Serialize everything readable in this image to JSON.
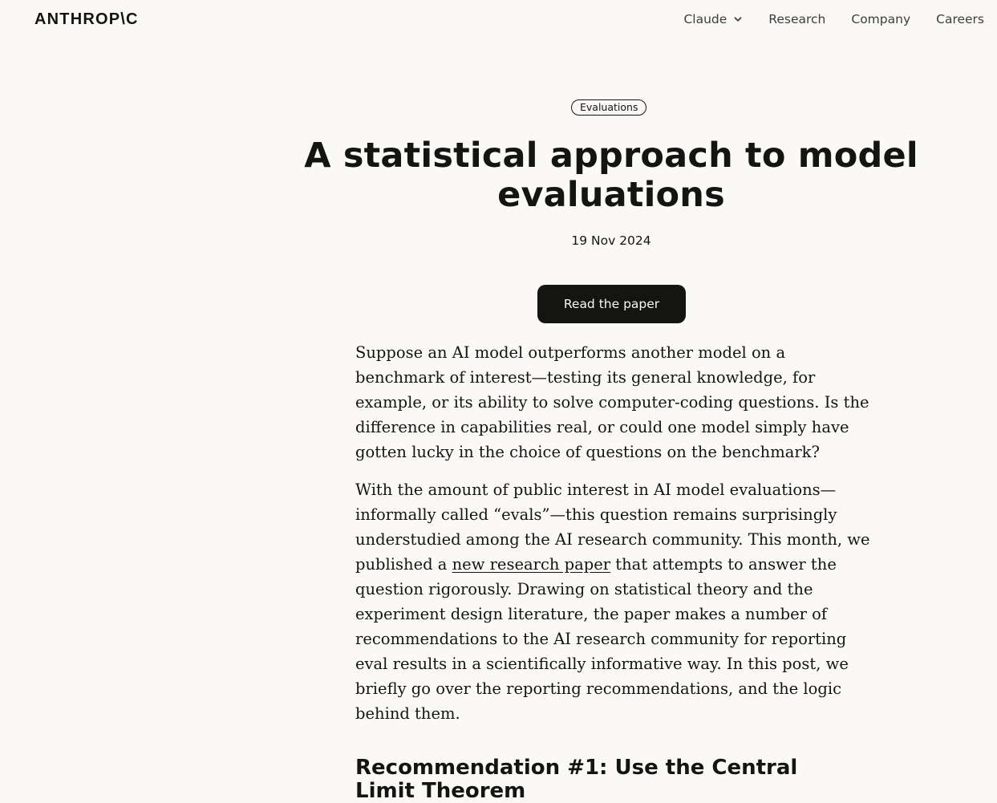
{
  "header": {
    "logo_text": "ANTHROP\\C",
    "nav": {
      "claude": "Claude",
      "research": "Research",
      "company": "Company",
      "careers": "Careers"
    }
  },
  "article": {
    "tag": "Evaluations",
    "title": "A statistical approach to model evaluations",
    "date": "19 Nov 2024",
    "read_button": "Read the paper",
    "paragraph1": "Suppose an AI model outperforms another model on a benchmark of interest—testing its general knowledge, for example, or its ability to solve computer-coding questions. Is the difference in capabilities real, or could one model simply have gotten lucky in the choice of questions on the benchmark?",
    "paragraph2_before_link": "With the amount of public interest in AI model evaluations—informally called “evals”—this question remains surprisingly understudied among the AI research community. This month, we published a ",
    "paragraph2_link": "new research paper",
    "paragraph2_after_link": " that attempts to answer the question rigorously. Drawing on statistical theory and the experiment design literature, the paper makes a number of recommendations to the AI research community for reporting eval results in a scientifically informative way. In this post, we briefly go over the reporting recommendations, and the logic behind them.",
    "heading1": "Recommendation #1: Use the Central Limit Theorem"
  },
  "icons": {
    "dropdown": "chevron-down-icon"
  }
}
